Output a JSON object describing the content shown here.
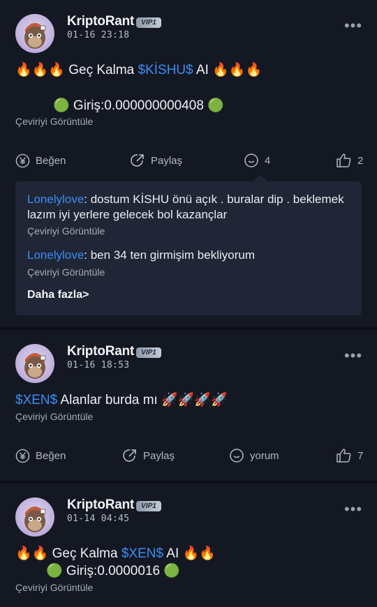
{
  "posts": [
    {
      "username": "KriptoRant",
      "badge": "VIP1",
      "time": "01-16 23:18",
      "line1": {
        "prefix": "🔥🔥🔥 Geç Kalma ",
        "tag": "$KİSHU$",
        "suffix": " AI 🔥🔥🔥"
      },
      "line2": "🟢 Giriş:0.000000000408 🟢",
      "translate": "Çeviriyi Görüntüle",
      "actions": {
        "like": "Beğen",
        "share": "Paylaş",
        "comment": "4",
        "thumbs": "2"
      },
      "comments": [
        {
          "user": "Lonelylove",
          "text": ": dostum KİSHU önü açık . buralar dip . beklemek lazım iyi yerlere gelecek bol kazançlar",
          "translate": "Çeviriyi Görüntüle"
        },
        {
          "user": "Lonelylove",
          "text": ": ben 34 ten girmişim bekliyorum",
          "translate": "Çeviriyi Görüntüle"
        }
      ],
      "more": "Daha fazla>"
    },
    {
      "username": "KriptoRant",
      "badge": "VIP1",
      "time": "01-16 18:53",
      "line1": {
        "prefix": "",
        "tag": "$XEN$",
        "suffix": " Alanlar burda mı 🚀🚀🚀🚀"
      },
      "translate": "Çeviriyi Görüntüle",
      "actions": {
        "like": "Beğen",
        "share": "Paylaş",
        "comment": "yorum",
        "thumbs": "7"
      }
    },
    {
      "username": "KriptoRant",
      "badge": "VIP1",
      "time": "01-14 04:45",
      "line1": {
        "prefix": "🔥🔥 Geç Kalma ",
        "tag": "$XEN$",
        "suffix": " AI 🔥🔥"
      },
      "line2": "🟢 Giriş:0.0000016 🟢",
      "translate": "Çeviriyi Görüntüle"
    }
  ],
  "icons": {
    "like": "yen-circle-icon",
    "share": "share-arrow-icon",
    "comment": "comment-bubble-icon",
    "thumbs": "thumbs-up-icon",
    "more": "more-dots-icon"
  },
  "colors": {
    "background": "#141822",
    "accent": "#3a8cf6",
    "comment_box": "#202635"
  }
}
